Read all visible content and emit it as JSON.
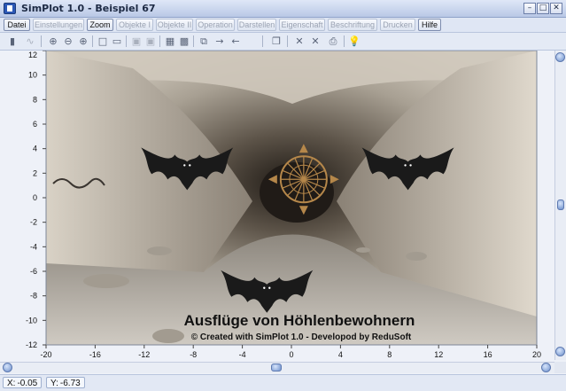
{
  "window": {
    "title": "SimPlot 1.0 - Beispiel 67",
    "minimize_glyph": "–",
    "maximize_glyph": "□",
    "close_glyph": "✕"
  },
  "menu": [
    {
      "label": "Datei",
      "enabled": true
    },
    {
      "label": "Einstellungen",
      "enabled": false
    },
    {
      "label": "Zoom",
      "enabled": true
    },
    {
      "label": "Objekte I",
      "enabled": false
    },
    {
      "label": "Objekte II",
      "enabled": false
    },
    {
      "label": "Operation",
      "enabled": false
    },
    {
      "label": "Darstellen",
      "enabled": false
    },
    {
      "label": "Eigenschaft",
      "enabled": false
    },
    {
      "label": "Beschriftung",
      "enabled": false
    },
    {
      "label": "Drucken",
      "enabled": false
    },
    {
      "label": "Hilfe",
      "enabled": true
    }
  ],
  "toolbar": [
    {
      "icon": "calculator-icon",
      "glyph": "▮"
    },
    {
      "icon": "function-icon",
      "glyph": "∿"
    },
    {
      "icon": "zoom-in-icon",
      "glyph": "⊕"
    },
    {
      "icon": "zoom-out-icon",
      "glyph": "⊖"
    },
    {
      "icon": "zoom-fit-icon",
      "glyph": "⊕"
    },
    {
      "icon": "square-icon",
      "glyph": "□"
    },
    {
      "icon": "grid-icon",
      "glyph": "▭"
    },
    {
      "icon": "frame-icon",
      "glyph": "▣"
    },
    {
      "icon": "frame2-icon",
      "glyph": "▣"
    },
    {
      "icon": "table-icon",
      "glyph": "▦"
    },
    {
      "icon": "settings-icon",
      "glyph": "▩"
    },
    {
      "icon": "copy-icon",
      "glyph": "⧉"
    },
    {
      "icon": "arrow-right-icon",
      "glyph": "→"
    },
    {
      "icon": "arrow-left-icon",
      "glyph": "←"
    },
    {
      "icon": "page-icon",
      "glyph": "❐"
    },
    {
      "icon": "close-x-icon",
      "glyph": "✕"
    },
    {
      "icon": "close-x2-icon",
      "glyph": "✕"
    },
    {
      "icon": "print-icon",
      "glyph": "⎙"
    },
    {
      "icon": "help-bulb-icon",
      "glyph": "💡"
    }
  ],
  "plot": {
    "caption": "Ausflüge von Höhlenbewohnern",
    "credit": "© Created with SimPlot 1.0 - Developod by ReduSoft",
    "x_ticks": [
      "-20",
      "-16",
      "-12",
      "-8",
      "-4",
      "0",
      "4",
      "8",
      "12",
      "16",
      "20"
    ],
    "y_ticks": [
      "12",
      "10",
      "8",
      "6",
      "4",
      "2",
      "0",
      "-2",
      "-4",
      "-6",
      "-8",
      "-10",
      "-12"
    ],
    "xlim": [
      -20,
      20
    ],
    "ylim": [
      -12,
      12
    ],
    "colors": {
      "rock_light": "#cfc8bd",
      "rock_dark": "#6f665b",
      "floor": "#bdb8b0",
      "tunnel_dark": "#2a2420",
      "bat": "#1a1a1a",
      "compass": "#b5874a"
    },
    "bats": [
      {
        "name": "bat-left",
        "x": -8.5,
        "y": 2.5
      },
      {
        "name": "bat-right",
        "x": 9.5,
        "y": 2.5
      },
      {
        "name": "bat-bottom",
        "x": -2,
        "y": -7.5
      }
    ],
    "compass": {
      "x": 1,
      "y": 1.5
    }
  },
  "status": {
    "x_label": "X:",
    "x_value": "-0.05",
    "y_label": "Y:",
    "y_value": "-6.73"
  }
}
